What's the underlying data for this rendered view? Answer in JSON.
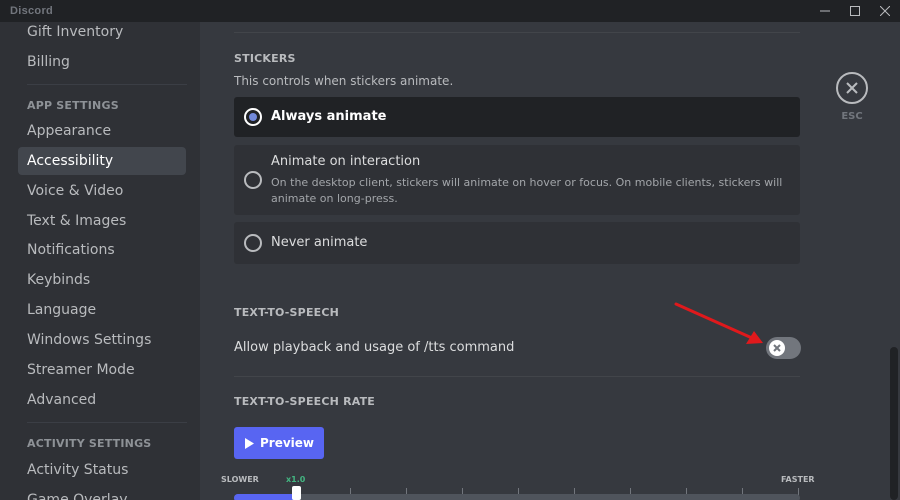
{
  "window": {
    "app_name": "Discord",
    "controls": [
      "minimize",
      "maximize",
      "close"
    ]
  },
  "sidebar": {
    "user_items": [
      {
        "label": "Gift Inventory"
      },
      {
        "label": "Billing"
      }
    ],
    "app_header": "APP SETTINGS",
    "app_items": [
      {
        "label": "Appearance",
        "selected": false
      },
      {
        "label": "Accessibility",
        "selected": true
      },
      {
        "label": "Voice & Video",
        "selected": false
      },
      {
        "label": "Text & Images",
        "selected": false
      },
      {
        "label": "Notifications",
        "selected": false
      },
      {
        "label": "Keybinds",
        "selected": false
      },
      {
        "label": "Language",
        "selected": false
      },
      {
        "label": "Windows Settings",
        "selected": false
      },
      {
        "label": "Streamer Mode",
        "selected": false
      },
      {
        "label": "Advanced",
        "selected": false
      }
    ],
    "activity_header": "ACTIVITY SETTINGS",
    "activity_items": [
      {
        "label": "Activity Status"
      },
      {
        "label": "Game Overlay"
      }
    ]
  },
  "stickers": {
    "title": "STICKERS",
    "description": "This controls when stickers animate.",
    "options": [
      {
        "label": "Always animate",
        "description": "",
        "selected": true
      },
      {
        "label": "Animate on interaction",
        "description": "On the desktop client, stickers will animate on hover or focus. On mobile clients, stickers will animate on long-press.",
        "selected": false
      },
      {
        "label": "Never animate",
        "description": "",
        "selected": false
      }
    ]
  },
  "tts": {
    "title": "TEXT-TO-SPEECH",
    "toggle_label": "Allow playback and usage of /tts command",
    "toggle_on": false
  },
  "tts_rate": {
    "title": "TEXT-TO-SPEECH RATE",
    "preview_label": "Preview",
    "slider_min_label": "SLOWER",
    "slider_max_label": "FASTER",
    "current_marker": "x1.0",
    "value_fraction": 0.11
  },
  "close": {
    "esc_label": "ESC"
  },
  "colors": {
    "accent": "#5865f2",
    "radio_dot": "#7289da",
    "marker_green": "#43b581",
    "annotation_arrow": "#e0191c"
  }
}
